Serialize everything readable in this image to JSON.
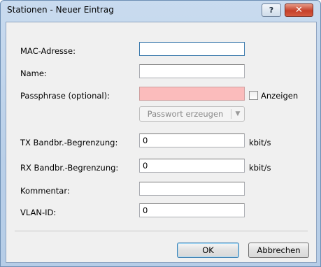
{
  "window": {
    "title": "Stationen - Neuer Eintrag",
    "help_glyph": "?",
    "close_glyph": "✕"
  },
  "form": {
    "mac": {
      "label": "MAC-Adresse:",
      "value": ""
    },
    "name": {
      "label": "Name:",
      "value": ""
    },
    "passphrase": {
      "label": "Passphrase (optional):",
      "value": "",
      "show_label": "Anzeigen",
      "show_checked": false
    },
    "generate": {
      "label": "Passwort erzeugen",
      "arrow": "▼"
    },
    "tx": {
      "label": "TX Bandbr.-Begrenzung:",
      "value": "0",
      "unit": "kbit/s"
    },
    "rx": {
      "label": "RX Bandbr.-Begrenzung:",
      "value": "0",
      "unit": "kbit/s"
    },
    "comment": {
      "label": "Kommentar:",
      "value": ""
    },
    "vlan": {
      "label": "VLAN-ID:",
      "value": "0"
    }
  },
  "buttons": {
    "ok": "OK",
    "cancel": "Abbrechen"
  },
  "colors": {
    "passphrase_invalid": "#fbbcbc",
    "title_bar": "#c9dbef",
    "close_button": "#c5402a"
  }
}
